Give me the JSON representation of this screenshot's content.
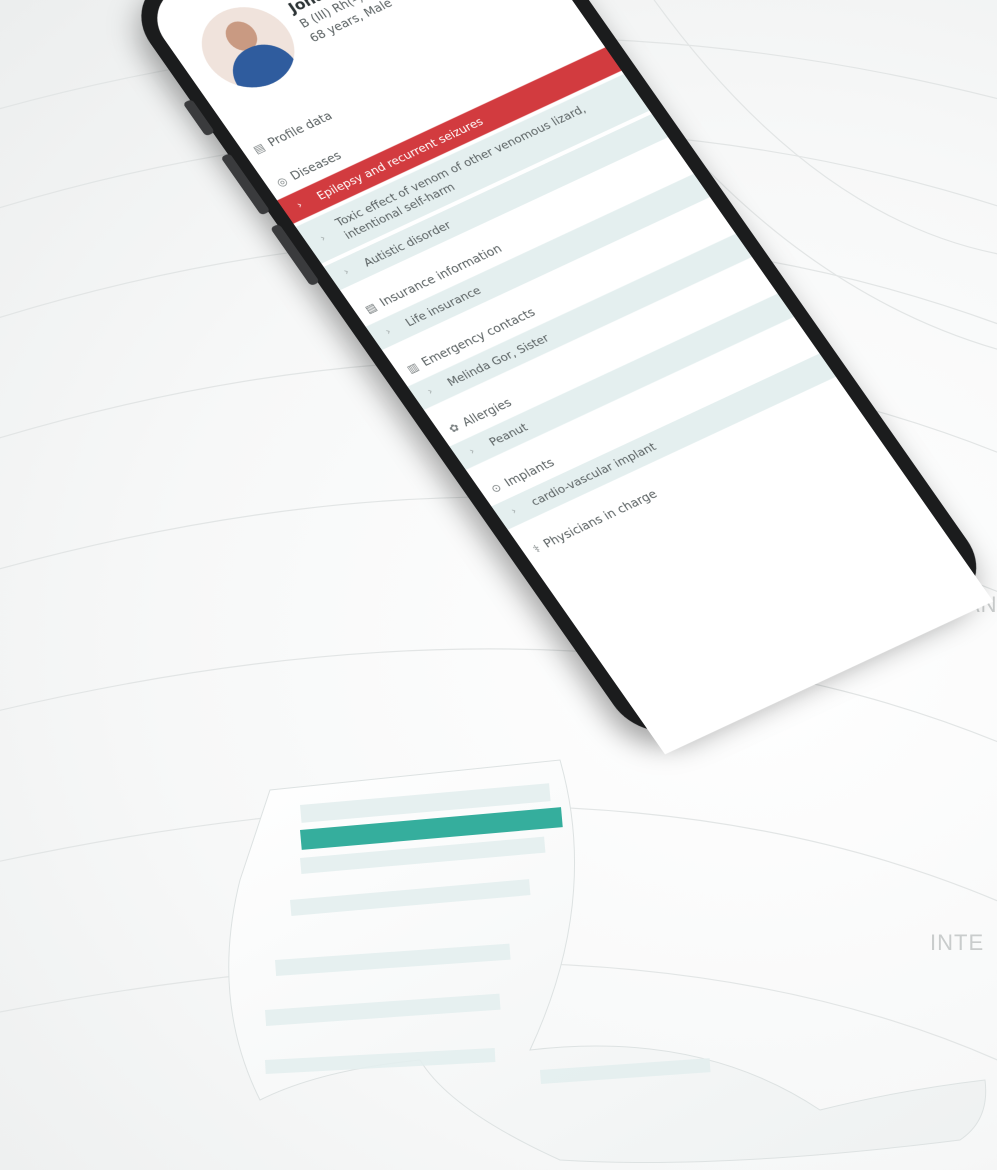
{
  "profile": {
    "name": "Jonathan Banks",
    "blood_type": "B (III) Rh(–)",
    "age_sex": "68 years, Male"
  },
  "sections": [
    {
      "key": "profile",
      "icon": "id-card-icon",
      "label": "Profile data",
      "items": []
    },
    {
      "key": "diseases",
      "icon": "diseases-icon",
      "label": "Diseases",
      "items": [
        {
          "label": "Epilepsy and recurrent seizures",
          "active": true
        },
        {
          "label": "Toxic effect of venom of other venomous lizard, intentional self-harm",
          "active": false
        },
        {
          "label": "Autistic disorder",
          "active": false
        }
      ]
    },
    {
      "key": "insurance",
      "icon": "insurance-icon",
      "label": "Insurance information",
      "items": [
        {
          "label": "Life insurance",
          "active": false
        }
      ]
    },
    {
      "key": "emergency",
      "icon": "contacts-icon",
      "label": "Emergency contacts",
      "items": [
        {
          "label": "Melinda Gor, Sister",
          "active": false
        }
      ]
    },
    {
      "key": "allergies",
      "icon": "allergy-icon",
      "label": "Allergies",
      "items": [
        {
          "label": "Peanut",
          "active": false
        }
      ]
    },
    {
      "key": "implants",
      "icon": "implant-icon",
      "label": "Implants",
      "items": [
        {
          "label": "cardio-vascular implant",
          "active": false
        }
      ]
    },
    {
      "key": "physicians",
      "icon": "physician-icon",
      "label": "Physicians in charge",
      "items": []
    }
  ],
  "side_text": [
    "AN",
    "INTE"
  ],
  "colors": {
    "accent_red": "#d23b3f",
    "accent_teal": "#1fa592",
    "row_bg": "#e4efef"
  }
}
